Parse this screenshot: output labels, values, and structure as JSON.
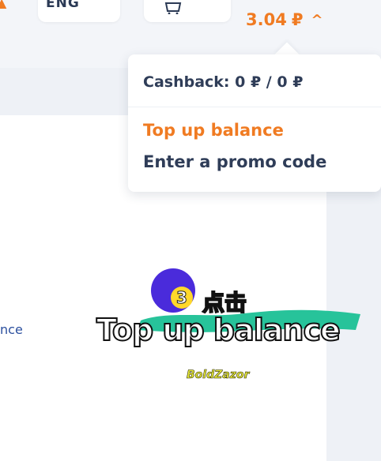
{
  "header": {
    "language_label": "ENG",
    "balance_amount": "3.04",
    "currency_symbol": "₽",
    "caret_glyph": "^"
  },
  "dropdown": {
    "cashback_text": "Cashback: 0 ₽ / 0 ₽",
    "top_up_label": "Top up balance",
    "promo_label": "Enter a promo code"
  },
  "page": {
    "side_text": "nce"
  },
  "overlay": {
    "step_number": "3",
    "caption_top": "点击",
    "caption_main": "Top up balance",
    "brand_text": "BoldZazor"
  },
  "colors": {
    "accent_orange": "#f07b22",
    "text_dark": "#2f3d58",
    "overlay_purple": "#4a2bdb",
    "overlay_yellow": "#ffd82b",
    "overlay_teal": "#27c39a"
  }
}
